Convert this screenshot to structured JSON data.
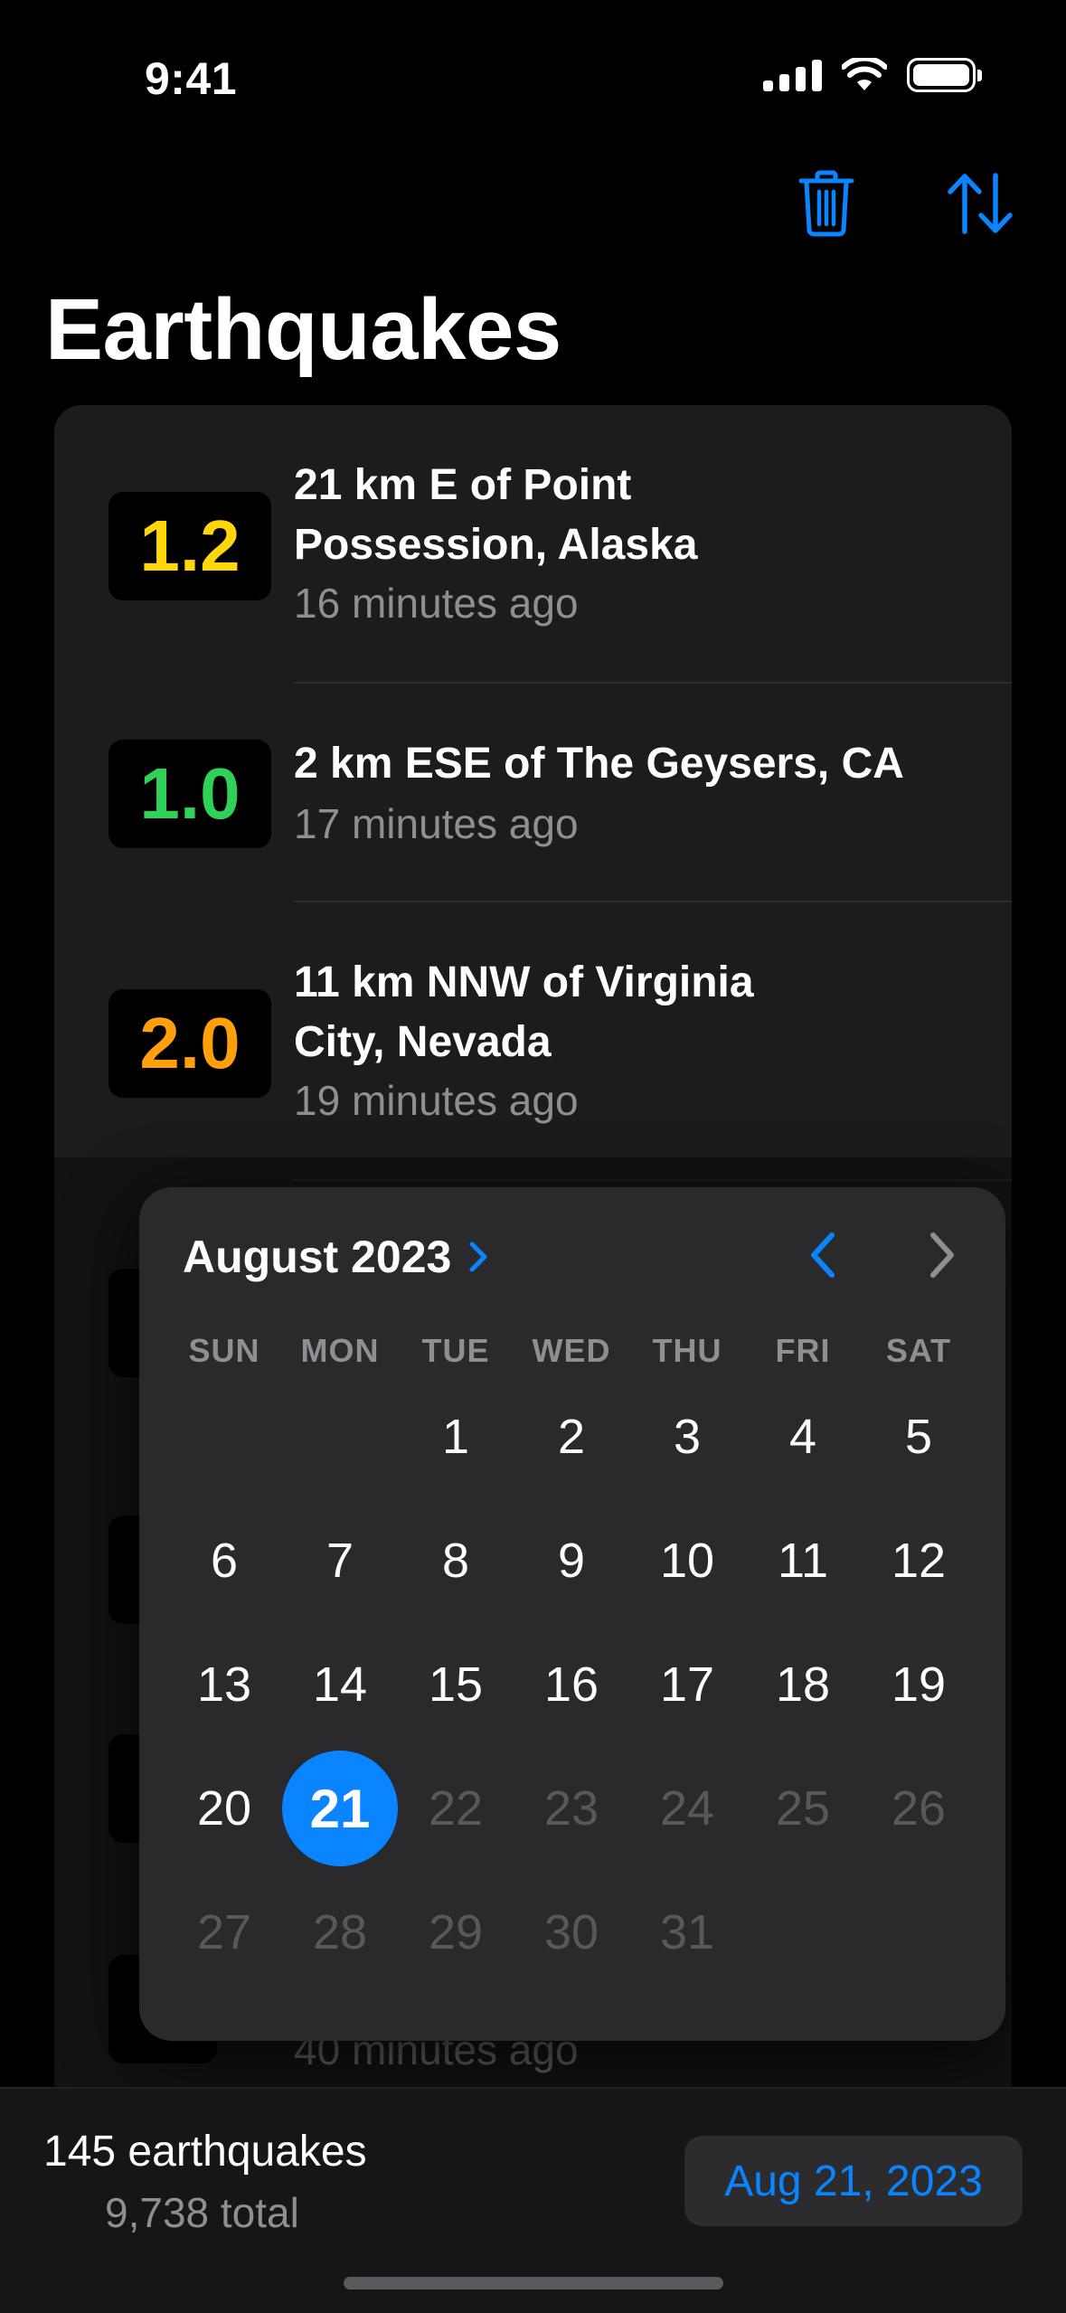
{
  "status_bar": {
    "time": "9:41"
  },
  "nav": {
    "title": "Earthquakes",
    "delete_icon": "trash-icon",
    "sort_icon": "sort-arrows-icon"
  },
  "quakes": [
    {
      "magnitude": "1.2",
      "color": "#ffd60a",
      "place_line1": "21 km E of Point",
      "place_line2": "Possession, Alaska",
      "time": "16 minutes ago"
    },
    {
      "magnitude": "1.0",
      "color": "#30d158",
      "place_line1": "2 km ESE of The Geysers, CA",
      "place_line2": "",
      "time": "17 minutes ago"
    },
    {
      "magnitude": "2.0",
      "color": "#ff9f0a",
      "place_line1": "11 km NNW of Virginia",
      "place_line2": "City, Nevada",
      "time": "19 minutes ago"
    },
    {
      "time": "40 minutes ago"
    }
  ],
  "calendar": {
    "month_label": "August 2023",
    "weekdays": [
      "SUN",
      "MON",
      "TUE",
      "WED",
      "THU",
      "FRI",
      "SAT"
    ],
    "days": [
      "1",
      "2",
      "3",
      "4",
      "5",
      "6",
      "7",
      "8",
      "9",
      "10",
      "11",
      "12",
      "13",
      "14",
      "15",
      "16",
      "17",
      "18",
      "19",
      "20",
      "21",
      "22",
      "23",
      "24",
      "25",
      "26",
      "27",
      "28",
      "29",
      "30",
      "31"
    ],
    "selected_day": "21",
    "accent": "#0a84ff"
  },
  "toolbar": {
    "count": "145 earthquakes",
    "total": "9,738 total",
    "date_button": "Aug 21, 2023"
  }
}
